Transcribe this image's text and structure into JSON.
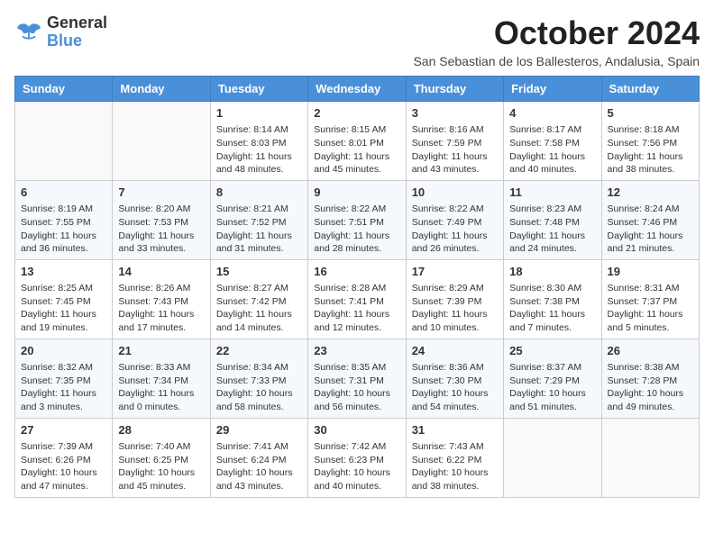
{
  "logo": {
    "line1": "General",
    "line2": "Blue"
  },
  "title": "October 2024",
  "subtitle": "San Sebastian de los Ballesteros, Andalusia, Spain",
  "days_of_week": [
    "Sunday",
    "Monday",
    "Tuesday",
    "Wednesday",
    "Thursday",
    "Friday",
    "Saturday"
  ],
  "weeks": [
    [
      {
        "day": null
      },
      {
        "day": null
      },
      {
        "day": "1",
        "sunrise": "Sunrise: 8:14 AM",
        "sunset": "Sunset: 8:03 PM",
        "daylight": "Daylight: 11 hours and 48 minutes."
      },
      {
        "day": "2",
        "sunrise": "Sunrise: 8:15 AM",
        "sunset": "Sunset: 8:01 PM",
        "daylight": "Daylight: 11 hours and 45 minutes."
      },
      {
        "day": "3",
        "sunrise": "Sunrise: 8:16 AM",
        "sunset": "Sunset: 7:59 PM",
        "daylight": "Daylight: 11 hours and 43 minutes."
      },
      {
        "day": "4",
        "sunrise": "Sunrise: 8:17 AM",
        "sunset": "Sunset: 7:58 PM",
        "daylight": "Daylight: 11 hours and 40 minutes."
      },
      {
        "day": "5",
        "sunrise": "Sunrise: 8:18 AM",
        "sunset": "Sunset: 7:56 PM",
        "daylight": "Daylight: 11 hours and 38 minutes."
      }
    ],
    [
      {
        "day": "6",
        "sunrise": "Sunrise: 8:19 AM",
        "sunset": "Sunset: 7:55 PM",
        "daylight": "Daylight: 11 hours and 36 minutes."
      },
      {
        "day": "7",
        "sunrise": "Sunrise: 8:20 AM",
        "sunset": "Sunset: 7:53 PM",
        "daylight": "Daylight: 11 hours and 33 minutes."
      },
      {
        "day": "8",
        "sunrise": "Sunrise: 8:21 AM",
        "sunset": "Sunset: 7:52 PM",
        "daylight": "Daylight: 11 hours and 31 minutes."
      },
      {
        "day": "9",
        "sunrise": "Sunrise: 8:22 AM",
        "sunset": "Sunset: 7:51 PM",
        "daylight": "Daylight: 11 hours and 28 minutes."
      },
      {
        "day": "10",
        "sunrise": "Sunrise: 8:22 AM",
        "sunset": "Sunset: 7:49 PM",
        "daylight": "Daylight: 11 hours and 26 minutes."
      },
      {
        "day": "11",
        "sunrise": "Sunrise: 8:23 AM",
        "sunset": "Sunset: 7:48 PM",
        "daylight": "Daylight: 11 hours and 24 minutes."
      },
      {
        "day": "12",
        "sunrise": "Sunrise: 8:24 AM",
        "sunset": "Sunset: 7:46 PM",
        "daylight": "Daylight: 11 hours and 21 minutes."
      }
    ],
    [
      {
        "day": "13",
        "sunrise": "Sunrise: 8:25 AM",
        "sunset": "Sunset: 7:45 PM",
        "daylight": "Daylight: 11 hours and 19 minutes."
      },
      {
        "day": "14",
        "sunrise": "Sunrise: 8:26 AM",
        "sunset": "Sunset: 7:43 PM",
        "daylight": "Daylight: 11 hours and 17 minutes."
      },
      {
        "day": "15",
        "sunrise": "Sunrise: 8:27 AM",
        "sunset": "Sunset: 7:42 PM",
        "daylight": "Daylight: 11 hours and 14 minutes."
      },
      {
        "day": "16",
        "sunrise": "Sunrise: 8:28 AM",
        "sunset": "Sunset: 7:41 PM",
        "daylight": "Daylight: 11 hours and 12 minutes."
      },
      {
        "day": "17",
        "sunrise": "Sunrise: 8:29 AM",
        "sunset": "Sunset: 7:39 PM",
        "daylight": "Daylight: 11 hours and 10 minutes."
      },
      {
        "day": "18",
        "sunrise": "Sunrise: 8:30 AM",
        "sunset": "Sunset: 7:38 PM",
        "daylight": "Daylight: 11 hours and 7 minutes."
      },
      {
        "day": "19",
        "sunrise": "Sunrise: 8:31 AM",
        "sunset": "Sunset: 7:37 PM",
        "daylight": "Daylight: 11 hours and 5 minutes."
      }
    ],
    [
      {
        "day": "20",
        "sunrise": "Sunrise: 8:32 AM",
        "sunset": "Sunset: 7:35 PM",
        "daylight": "Daylight: 11 hours and 3 minutes."
      },
      {
        "day": "21",
        "sunrise": "Sunrise: 8:33 AM",
        "sunset": "Sunset: 7:34 PM",
        "daylight": "Daylight: 11 hours and 0 minutes."
      },
      {
        "day": "22",
        "sunrise": "Sunrise: 8:34 AM",
        "sunset": "Sunset: 7:33 PM",
        "daylight": "Daylight: 10 hours and 58 minutes."
      },
      {
        "day": "23",
        "sunrise": "Sunrise: 8:35 AM",
        "sunset": "Sunset: 7:31 PM",
        "daylight": "Daylight: 10 hours and 56 minutes."
      },
      {
        "day": "24",
        "sunrise": "Sunrise: 8:36 AM",
        "sunset": "Sunset: 7:30 PM",
        "daylight": "Daylight: 10 hours and 54 minutes."
      },
      {
        "day": "25",
        "sunrise": "Sunrise: 8:37 AM",
        "sunset": "Sunset: 7:29 PM",
        "daylight": "Daylight: 10 hours and 51 minutes."
      },
      {
        "day": "26",
        "sunrise": "Sunrise: 8:38 AM",
        "sunset": "Sunset: 7:28 PM",
        "daylight": "Daylight: 10 hours and 49 minutes."
      }
    ],
    [
      {
        "day": "27",
        "sunrise": "Sunrise: 7:39 AM",
        "sunset": "Sunset: 6:26 PM",
        "daylight": "Daylight: 10 hours and 47 minutes."
      },
      {
        "day": "28",
        "sunrise": "Sunrise: 7:40 AM",
        "sunset": "Sunset: 6:25 PM",
        "daylight": "Daylight: 10 hours and 45 minutes."
      },
      {
        "day": "29",
        "sunrise": "Sunrise: 7:41 AM",
        "sunset": "Sunset: 6:24 PM",
        "daylight": "Daylight: 10 hours and 43 minutes."
      },
      {
        "day": "30",
        "sunrise": "Sunrise: 7:42 AM",
        "sunset": "Sunset: 6:23 PM",
        "daylight": "Daylight: 10 hours and 40 minutes."
      },
      {
        "day": "31",
        "sunrise": "Sunrise: 7:43 AM",
        "sunset": "Sunset: 6:22 PM",
        "daylight": "Daylight: 10 hours and 38 minutes."
      },
      {
        "day": null
      },
      {
        "day": null
      }
    ]
  ]
}
